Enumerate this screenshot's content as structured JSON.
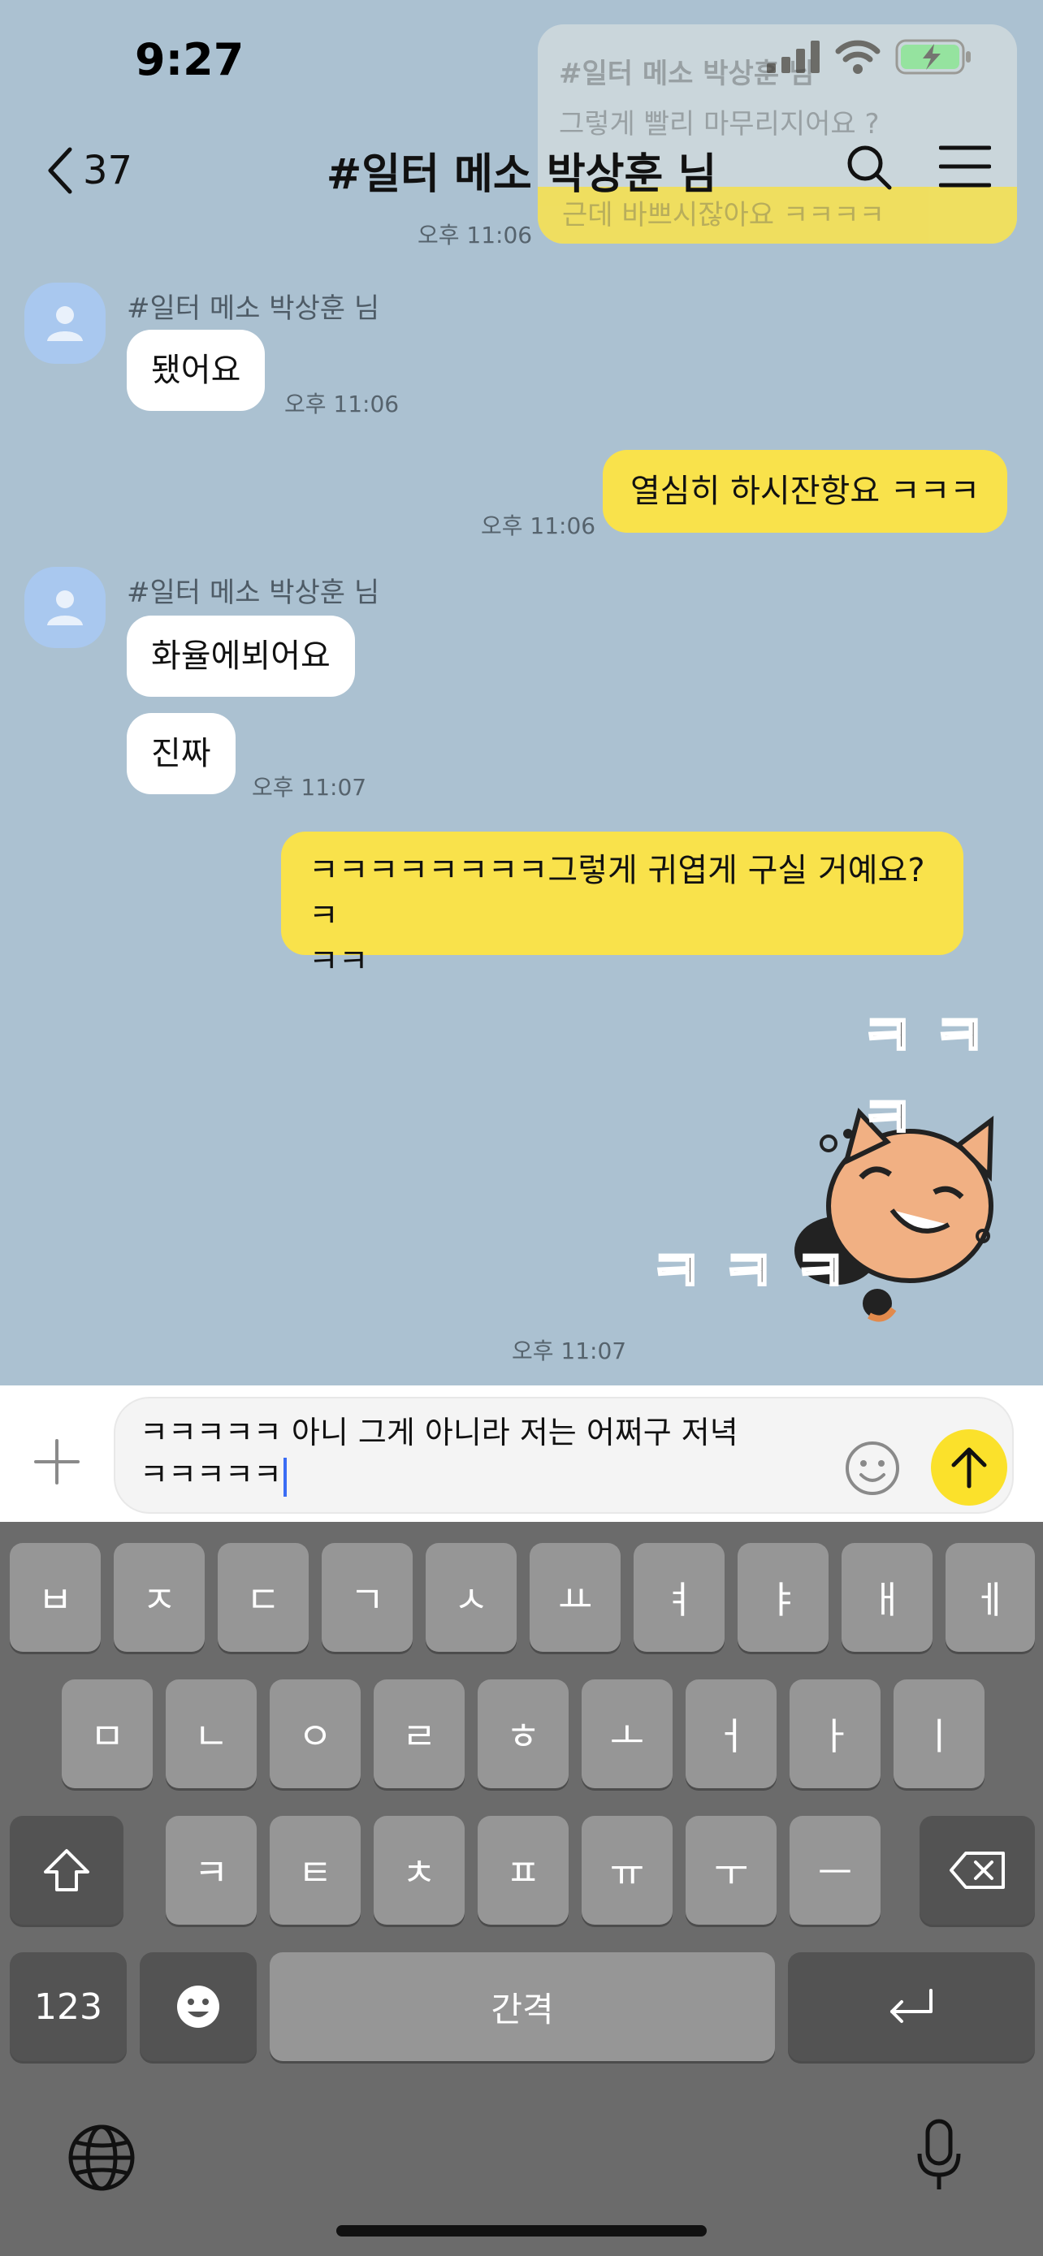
{
  "status": {
    "time": "9:27"
  },
  "preview": {
    "line1": "#일터 메소 박상훈 님",
    "line2": "그렇게 빨리 마무리지어요 ?",
    "line3": "근데 바쁘시잖아요 ㅋㅋㅋㅋ"
  },
  "header": {
    "back_count": "37",
    "title": "#일터 메소 박상훈 님"
  },
  "messages": {
    "m0_time": "오후 11:06",
    "g1_sender": "#일터 메소 박상훈 님",
    "g1_text": "됐어요",
    "g1_time": "오후 11:06",
    "me1_text": "열심히 하시잔항요 ㅋㅋㅋ",
    "me1_time": "오후 11:06",
    "g2_sender": "#일터 메소 박상훈 님",
    "g2_text1": "화율에뵈어요",
    "g2_text2": "진짜",
    "g2_time": "오후 11:07",
    "me2_line1": "ㅋㅋㅋㅋㅋㅋㅋㅋ그렇게 귀엽게 구실 거예요? ㅋ",
    "me2_line2": "ㅋㅋ",
    "sticker_text_top": "ㅋ ㅋ ㅋ",
    "sticker_text_bottom": "ㅋ ㅋ ㅋ",
    "sticker_time": "오후 11:07"
  },
  "input": {
    "line1": "ㅋㅋㅋㅋㅋ 아니 그게 아니라 저는 어쩌구 저녁",
    "line2": "ㅋㅋㅋㅋㅋ"
  },
  "keyboard": {
    "row1": [
      "ㅂ",
      "ㅈ",
      "ㄷ",
      "ㄱ",
      "ㅅ",
      "ㅛ",
      "ㅕ",
      "ㅑ",
      "ㅐ",
      "ㅔ"
    ],
    "row2": [
      "ㅁ",
      "ㄴ",
      "ㅇ",
      "ㄹ",
      "ㅎ",
      "ㅗ",
      "ㅓ",
      "ㅏ",
      "ㅣ"
    ],
    "row3": [
      "ㅋ",
      "ㅌ",
      "ㅊ",
      "ㅍ",
      "ㅠ",
      "ㅜ",
      "ㅡ"
    ],
    "num_key": "123",
    "space_key": "간격"
  },
  "colors": {
    "chat_bg": "#abc1d1",
    "my_bubble": "#f9e24b",
    "send_button": "#fbe12b"
  }
}
